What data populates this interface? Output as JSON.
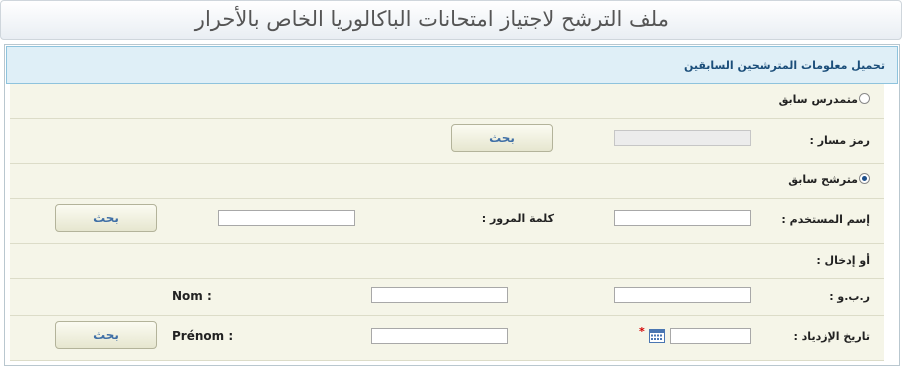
{
  "page": {
    "title": "ملف الترشح لاجتياز امتحانات الباكالوريا الخاص بالأحرار"
  },
  "section": {
    "title": "تحميل معلومات المترشحين السابقين"
  },
  "radio_prev_student": {
    "label": "متمدرس سابق",
    "checked": false
  },
  "row_massar": {
    "label": "رمز مسار :",
    "value": "",
    "button": "بحث"
  },
  "radio_prev_candidate": {
    "label": "مترشح سابق",
    "checked": true
  },
  "row_login": {
    "username_label": "إسم المستخدم :",
    "username_value": "",
    "password_label": "كلمة المرور :",
    "password_value": "",
    "button": "بحث"
  },
  "or_enter": {
    "label": "أو إدخال :"
  },
  "row_cin": {
    "cin_label": "ر.ب.و :",
    "cin_value": "",
    "nom_label": "Nom :",
    "nom_value": ""
  },
  "row_birth": {
    "birth_label": "تاريخ الإزدياد :",
    "birth_value": "",
    "required_mark": "*",
    "prenom_label": "Prénom :",
    "prenom_value": "",
    "button": "بحث"
  },
  "colors": {
    "accent": "#1b4e7a",
    "button_text": "#3f6fa6",
    "row_bg": "#f5f5e8",
    "header_bg": "#dfeff7",
    "required": "#d40000"
  },
  "icons": {
    "calendar": "calendar-icon"
  }
}
